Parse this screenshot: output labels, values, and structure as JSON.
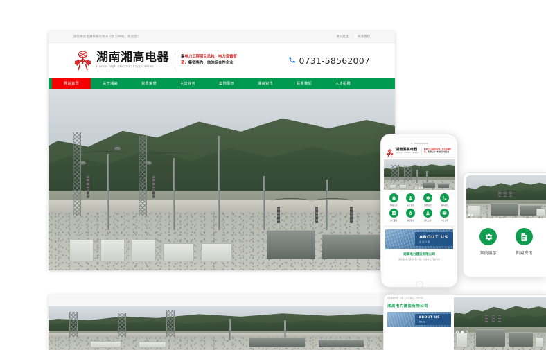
{
  "site": {
    "topbar": {
      "welcome": "湖南湘高电器科技有限公司官方网站，欢迎您！",
      "links": [
        "进入后台",
        "联系我们"
      ],
      "separator": "|"
    },
    "logo": {
      "cn": "湖南湘高电器",
      "en": "Hunan high electrical appliances",
      "mark": "company-logo-mark"
    },
    "slogan": {
      "line1_red": "电力工程项目总包、电力设备智",
      "line1_prefix": "集",
      "line2_red": "造",
      "line2_rest": "，集销售为一体的综合性企业"
    },
    "phone": {
      "icon": "phone-icon",
      "number": "0731-58562007"
    },
    "nav": [
      {
        "label": "网站首页",
        "active": true
      },
      {
        "label": "关于湘高",
        "active": false
      },
      {
        "label": "资质荣誉",
        "active": false
      },
      {
        "label": "主营业务",
        "active": false
      },
      {
        "label": "案例展示",
        "active": false
      },
      {
        "label": "湘高资讯",
        "active": false
      },
      {
        "label": "联系我们",
        "active": false
      },
      {
        "label": "人才招聘",
        "active": false
      }
    ],
    "hero": {
      "alt": "电力变电站设备实景",
      "slider_dots": 3,
      "active_dot": 1
    }
  },
  "mobile": {
    "grid": [
      {
        "label": "网站首页",
        "icon": "home-icon"
      },
      {
        "label": "关于湘高",
        "icon": "user-icon"
      },
      {
        "label": "案例展示",
        "icon": "gear-icon"
      },
      {
        "label": "联系我们",
        "icon": "phone-round-icon"
      },
      {
        "label": "关于湘高",
        "icon": "badge-icon"
      },
      {
        "label": "资质荣誉",
        "icon": "medal-icon"
      },
      {
        "label": "服务支持",
        "icon": "support-icon"
      },
      {
        "label": "人才招聘",
        "icon": "mail-icon"
      }
    ],
    "about": {
      "en": "ABOUT US",
      "cn": "企业介绍"
    },
    "company": "湘高电力建设有限公司",
    "description": "湖南湘高电力建设有限公司是一家集电力工程总包的"
  },
  "tablet": {
    "cards": [
      {
        "label": "案例展示",
        "icon": "gear-icon"
      },
      {
        "label": "新闻资讯",
        "icon": "document-icon"
      }
    ],
    "slider_dots": 2,
    "active_dot": 0
  },
  "wide": {
    "breadcrumb": "您当前的位置：首页 > 关于湘高 > 企业介绍",
    "title": "湘高电力建设有限公司",
    "about": {
      "en": "ABOUT US",
      "cn": "企业介绍"
    },
    "slider_dots": 3,
    "active_dot": 1
  },
  "colors": {
    "brand_green": "#009950",
    "accent_red": "#f40000",
    "icon_green": "#0f9d4f",
    "about_blue": "#1d4e84",
    "phone_blue": "#1f6ed4"
  }
}
